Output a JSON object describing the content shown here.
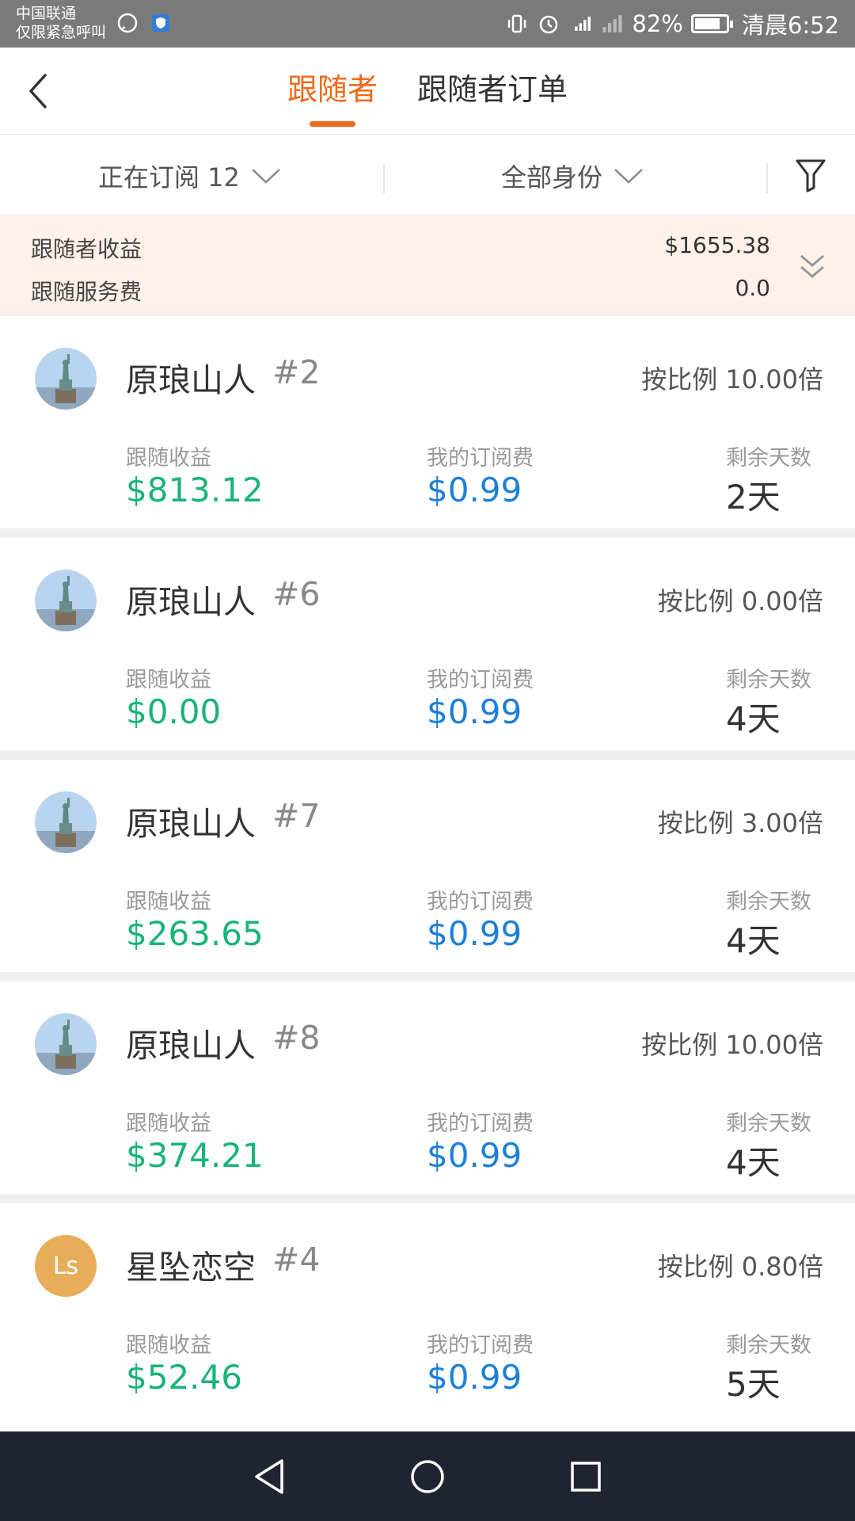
{
  "status_bar": {
    "carrier_line1": "中国联通",
    "carrier_line2": "仅限紧急呼叫",
    "battery_percent": "82%",
    "battery_level": 0.82,
    "time": "清晨6:52"
  },
  "header": {
    "tabs": [
      {
        "label": "跟随者",
        "active": true
      },
      {
        "label": "跟随者订单",
        "active": false
      }
    ]
  },
  "filters": {
    "subscription_label": "正在订阅 12",
    "identity_label": "全部身份"
  },
  "summary": {
    "earnings_label": "跟随者收益",
    "earnings_value": "$1655.38",
    "fee_label": "跟随服务费",
    "fee_value": "0.0"
  },
  "columns": {
    "earnings": "跟随收益",
    "fee": "我的订阅费",
    "days": "剩余天数"
  },
  "followers": [
    {
      "name": "原琅山人",
      "rank": "#2",
      "ratio": "按比例 10.00倍",
      "earnings": "$813.12",
      "fee": "$0.99",
      "days": "2天",
      "avatar": "statue"
    },
    {
      "name": "原琅山人",
      "rank": "#6",
      "ratio": "按比例 0.00倍",
      "earnings": "$0.00",
      "fee": "$0.99",
      "days": "4天",
      "avatar": "statue"
    },
    {
      "name": "原琅山人",
      "rank": "#7",
      "ratio": "按比例 3.00倍",
      "earnings": "$263.65",
      "fee": "$0.99",
      "days": "4天",
      "avatar": "statue"
    },
    {
      "name": "原琅山人",
      "rank": "#8",
      "ratio": "按比例 10.00倍",
      "earnings": "$374.21",
      "fee": "$0.99",
      "days": "4天",
      "avatar": "statue"
    },
    {
      "name": "星坠恋空",
      "rank": "#4",
      "ratio": "按比例 0.80倍",
      "earnings": "$52.46",
      "fee": "$0.99",
      "days": "5天",
      "avatar": "Ls"
    }
  ],
  "colors": {
    "accent": "#ef6a1a",
    "earnings": "#19b37a",
    "fee": "#1d7fd8",
    "summary_bg": "#fdf1ea",
    "status_bar": "#7a7a7a",
    "nav_bar": "#1f2430"
  },
  "icons": {
    "back": "chevron-left-icon",
    "dropdown": "chevron-down-icon",
    "filter": "funnel-icon",
    "expand": "double-chevron-down-icon"
  }
}
